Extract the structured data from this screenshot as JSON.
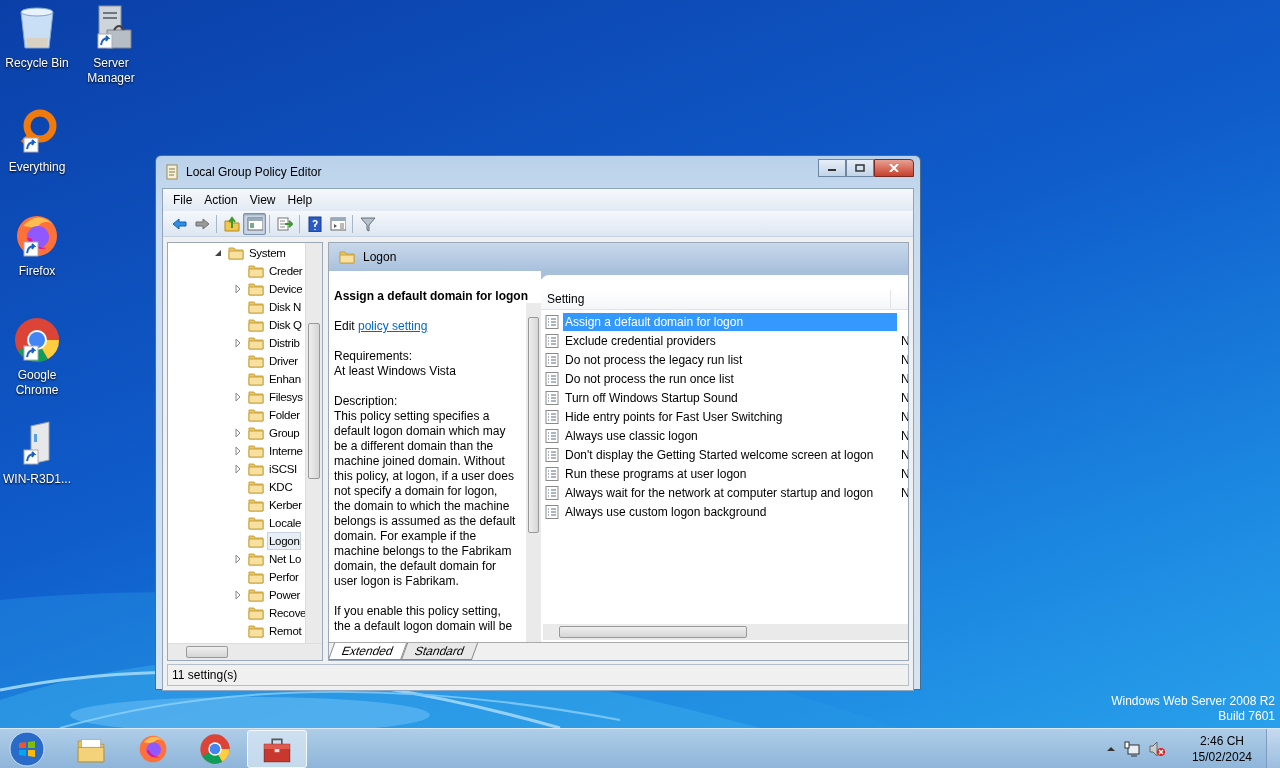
{
  "desktop_icons": [
    {
      "kind": "recycle-bin",
      "label": "Recycle Bin",
      "shortcut": false
    },
    {
      "kind": "server",
      "label": "Server Manager",
      "shortcut": true
    },
    {
      "kind": "ring",
      "label": "Everything",
      "shortcut": true
    },
    {
      "kind": "firefox",
      "label": "Firefox",
      "shortcut": true
    },
    {
      "kind": "chrome",
      "label": "Google Chrome",
      "shortcut": true
    },
    {
      "kind": "drive",
      "label": "WIN-R3D1...",
      "shortcut": true
    }
  ],
  "window": {
    "title": "Local Group Policy Editor",
    "menu": [
      "File",
      "Action",
      "View",
      "Help"
    ],
    "toolbar": [
      [
        {
          "kind": "back",
          "pressed": false
        },
        {
          "kind": "forward",
          "pressed": false
        }
      ],
      [
        {
          "kind": "up",
          "pressed": false
        },
        {
          "kind": "pane",
          "pressed": true
        }
      ],
      [
        {
          "kind": "export",
          "pressed": false
        }
      ],
      [
        {
          "kind": "help",
          "pressed": false
        },
        {
          "kind": "properties",
          "pressed": false
        }
      ],
      [
        {
          "kind": "filter",
          "pressed": false
        }
      ]
    ],
    "tree": [
      {
        "label": "System",
        "expanded": true,
        "selected": false,
        "children": [
          {
            "label": "Creder",
            "expandable": false,
            "selected": false
          },
          {
            "label": "Device",
            "expandable": true,
            "selected": false
          },
          {
            "label": "Disk N",
            "expandable": false,
            "selected": false
          },
          {
            "label": "Disk Q",
            "expandable": false,
            "selected": false
          },
          {
            "label": "Distrib",
            "expandable": true,
            "selected": false
          },
          {
            "label": "Driver",
            "expandable": false,
            "selected": false
          },
          {
            "label": "Enhan",
            "expandable": false,
            "selected": false
          },
          {
            "label": "Filesys",
            "expandable": true,
            "selected": false
          },
          {
            "label": "Folder",
            "expandable": false,
            "selected": false
          },
          {
            "label": "Group",
            "expandable": true,
            "selected": false
          },
          {
            "label": "Interne",
            "expandable": true,
            "selected": false
          },
          {
            "label": "iSCSI",
            "expandable": true,
            "selected": false
          },
          {
            "label": "KDC",
            "expandable": false,
            "selected": false
          },
          {
            "label": "Kerber",
            "expandable": false,
            "selected": false
          },
          {
            "label": "Locale",
            "expandable": false,
            "selected": false
          },
          {
            "label": "Logon",
            "expandable": false,
            "selected": true
          },
          {
            "label": "Net Lo",
            "expandable": true,
            "selected": false
          },
          {
            "label": "Perfor",
            "expandable": false,
            "selected": false
          },
          {
            "label": "Power",
            "expandable": true,
            "selected": false
          },
          {
            "label": "Recove",
            "expandable": false,
            "selected": false
          },
          {
            "label": "Remot",
            "expandable": false,
            "selected": false
          }
        ]
      }
    ],
    "pane_title": "Logon",
    "details": {
      "title": "Assign a default domain for logon",
      "edit_prefix": "Edit",
      "edit_link": "policy setting",
      "requirements_label": "Requirements:",
      "requirements": "At least Windows Vista",
      "description_label": "Description:",
      "description": "This policy setting specifies a default logon domain which may be a different domain than the machine joined domain. Without this policy, at logon, if a user does not specify a domain for logon, the domain to which the machine belongs is assumed as the default domain. For example if the machine belongs to the Fabrikam domain, the default domain for user logon is Fabrikam.",
      "more": "If you enable this policy setting, the a default logon domain will be"
    },
    "settings": {
      "columns": [
        "Setting"
      ],
      "rows": [
        {
          "name": "Assign a default domain for logon",
          "selected": true
        },
        {
          "name": "Exclude credential providers",
          "column_2": "N",
          "selected": false
        },
        {
          "name": "Do not process the legacy run list",
          "column_2": "N",
          "selected": false
        },
        {
          "name": "Do not process the run once list",
          "column_2": "N",
          "selected": false
        },
        {
          "name": "Turn off Windows Startup Sound",
          "column_2": "N",
          "selected": false
        },
        {
          "name": "Hide entry points for Fast User Switching",
          "column_2": "N",
          "selected": false
        },
        {
          "name": "Always use classic logon",
          "column_2": "N",
          "selected": false
        },
        {
          "name": "Don't display the Getting Started welcome screen at logon",
          "column_2": "N",
          "selected": false
        },
        {
          "name": "Run these programs at user logon",
          "column_2": "N",
          "selected": false
        },
        {
          "name": "Always wait for the network at computer startup and logon",
          "column_2": "N",
          "selected": false
        },
        {
          "name": "Always use custom logon background",
          "selected": false
        }
      ]
    },
    "tabs": [
      {
        "label": "Extended",
        "selected": true
      },
      {
        "label": "Standard",
        "selected": false
      }
    ],
    "status_bar": "11 setting(s)"
  },
  "watermark": [
    "Windows Web Server 2008 R2",
    "Build 7601"
  ],
  "taskbar": {
    "apps": [
      {
        "kind": "explorer",
        "active": false
      },
      {
        "kind": "firefox",
        "active": false
      },
      {
        "kind": "chrome",
        "active": false
      },
      {
        "kind": "toolbox",
        "active": true
      }
    ],
    "time": "2:46 CH",
    "date": "15/02/2024"
  }
}
